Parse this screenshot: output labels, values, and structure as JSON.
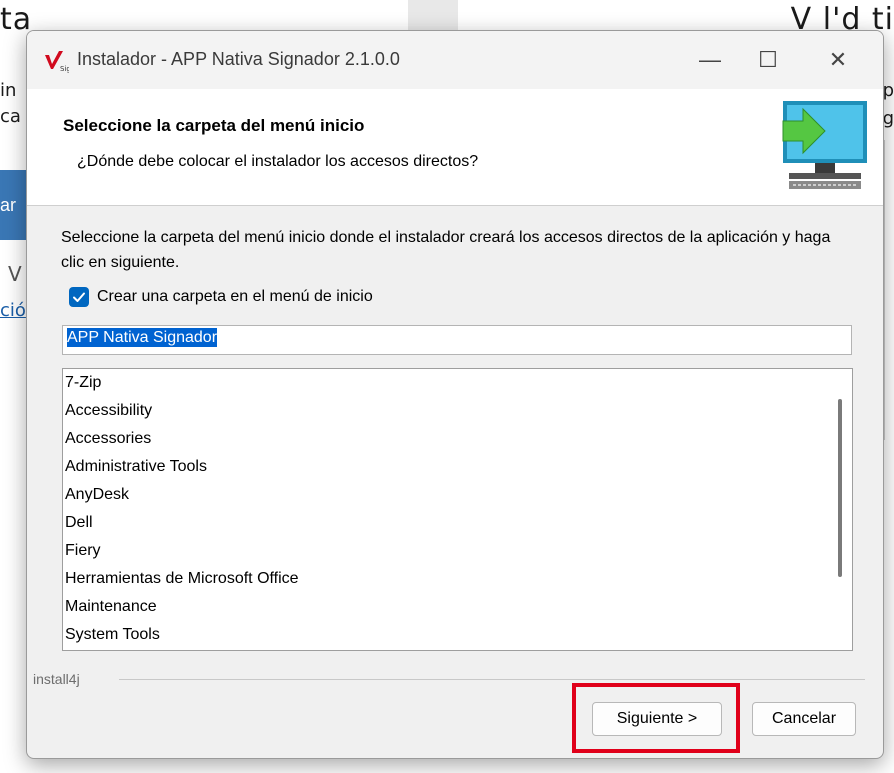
{
  "background": {
    "left_title": "ta",
    "left_line1": "in",
    "left_line2": "ca",
    "left_button": "ar",
    "left_letter": "V",
    "left_link": "ció",
    "right_title": "V l'd  ti",
    "right_line1": "p",
    "right_line2": "g"
  },
  "window": {
    "title": "Instalador - APP Nativa Signador 2.1.0.0",
    "minimize_symbol": "—",
    "maximize_symbol": "☐",
    "close_symbol": "✕"
  },
  "header": {
    "title": "Seleccione la carpeta del menú inicio",
    "subtitle": "¿Dónde debe colocar el instalador los accesos directos?"
  },
  "body": {
    "description": "Seleccione la carpeta del menú inicio donde el instalador creará los accesos directos de la aplicación y haga clic en siguiente.",
    "checkbox_label": "Crear una carpeta en el menú de inicio",
    "checkbox_checked": true,
    "folder_value": "APP Nativa Signador",
    "folders": [
      "7-Zip",
      "Accessibility",
      "Accessories",
      "Administrative Tools",
      "AnyDesk",
      "Dell",
      "Fiery",
      "Herramientas de Microsoft Office",
      "Maintenance",
      "System Tools"
    ]
  },
  "footer": {
    "brand": "install4j",
    "next_label": "Siguiente >",
    "cancel_label": "Cancelar"
  },
  "colors": {
    "accent": "#0067c0",
    "highlight": "#e0001a",
    "selection": "#0063d1"
  },
  "icons": {
    "app": "signador-logo-icon",
    "header": "monitor-arrow-icon",
    "check": "checkmark-icon"
  }
}
